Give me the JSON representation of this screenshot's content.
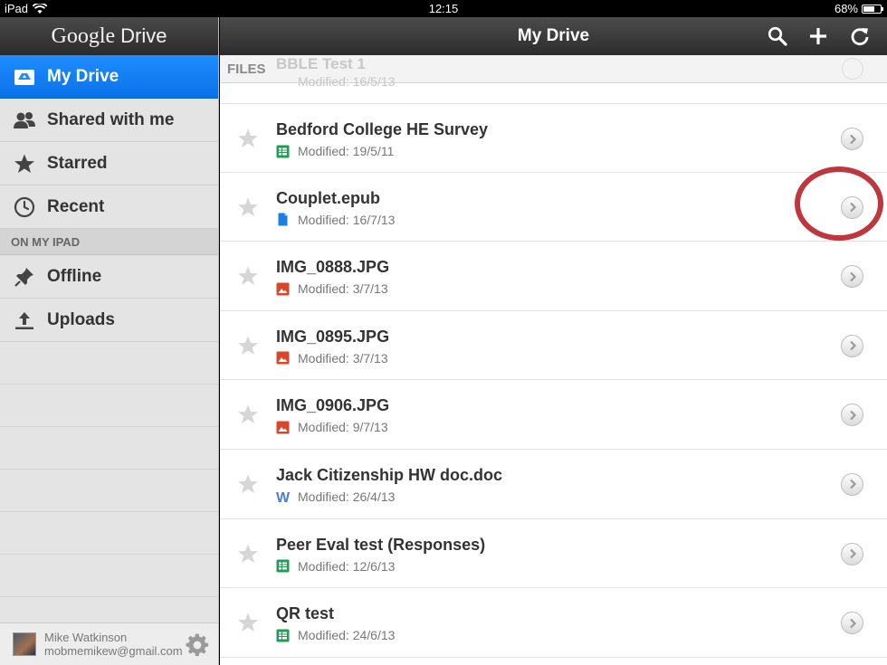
{
  "status_bar": {
    "device": "iPad",
    "time": "12:15",
    "battery": "68%",
    "battery_level": 0.68
  },
  "sidebar": {
    "logo_google": "Google",
    "logo_drive": "Drive",
    "items": [
      {
        "label": "My Drive",
        "icon": "drive-icon",
        "active": true
      },
      {
        "label": "Shared with me",
        "icon": "people-icon"
      },
      {
        "label": "Starred",
        "icon": "star-icon"
      },
      {
        "label": "Recent",
        "icon": "clock-icon"
      }
    ],
    "section_label": "ON MY IPAD",
    "device_items": [
      {
        "label": "Offline",
        "icon": "pin-icon"
      },
      {
        "label": "Uploads",
        "icon": "upload-icon"
      }
    ],
    "account": {
      "name": "Mike Watkinson",
      "email": "mobmemikew@gmail.com"
    }
  },
  "main": {
    "title": "My Drive",
    "files_label": "FILES",
    "ghost_row": {
      "name": "BBLE Test 1",
      "meta": "Modified: 16/5/13"
    },
    "files": [
      {
        "name": "Bedford College HE Survey",
        "modified": "Modified: 19/5/11",
        "type": "spreadsheet"
      },
      {
        "name": "Couplet.epub",
        "modified": "Modified: 16/7/13",
        "type": "file"
      },
      {
        "name": "IMG_0888.JPG",
        "modified": "Modified: 3/7/13",
        "type": "image"
      },
      {
        "name": "IMG_0895.JPG",
        "modified": "Modified: 3/7/13",
        "type": "image"
      },
      {
        "name": "IMG_0906.JPG",
        "modified": "Modified: 9/7/13",
        "type": "image"
      },
      {
        "name": "Jack Citizenship HW doc.doc",
        "modified": "Modified: 26/4/13",
        "type": "word"
      },
      {
        "name": "Peer Eval test (Responses)",
        "modified": "Modified: 12/6/13",
        "type": "spreadsheet"
      },
      {
        "name": "QR test",
        "modified": "Modified: 24/6/13",
        "type": "spreadsheet"
      }
    ]
  },
  "colors": {
    "accent": "#0a72e8",
    "highlight_circle": "#b8262e",
    "sheet_green": "#1e9e55",
    "image_red": "#d9472b",
    "word_blue": "#4a7fd0"
  }
}
